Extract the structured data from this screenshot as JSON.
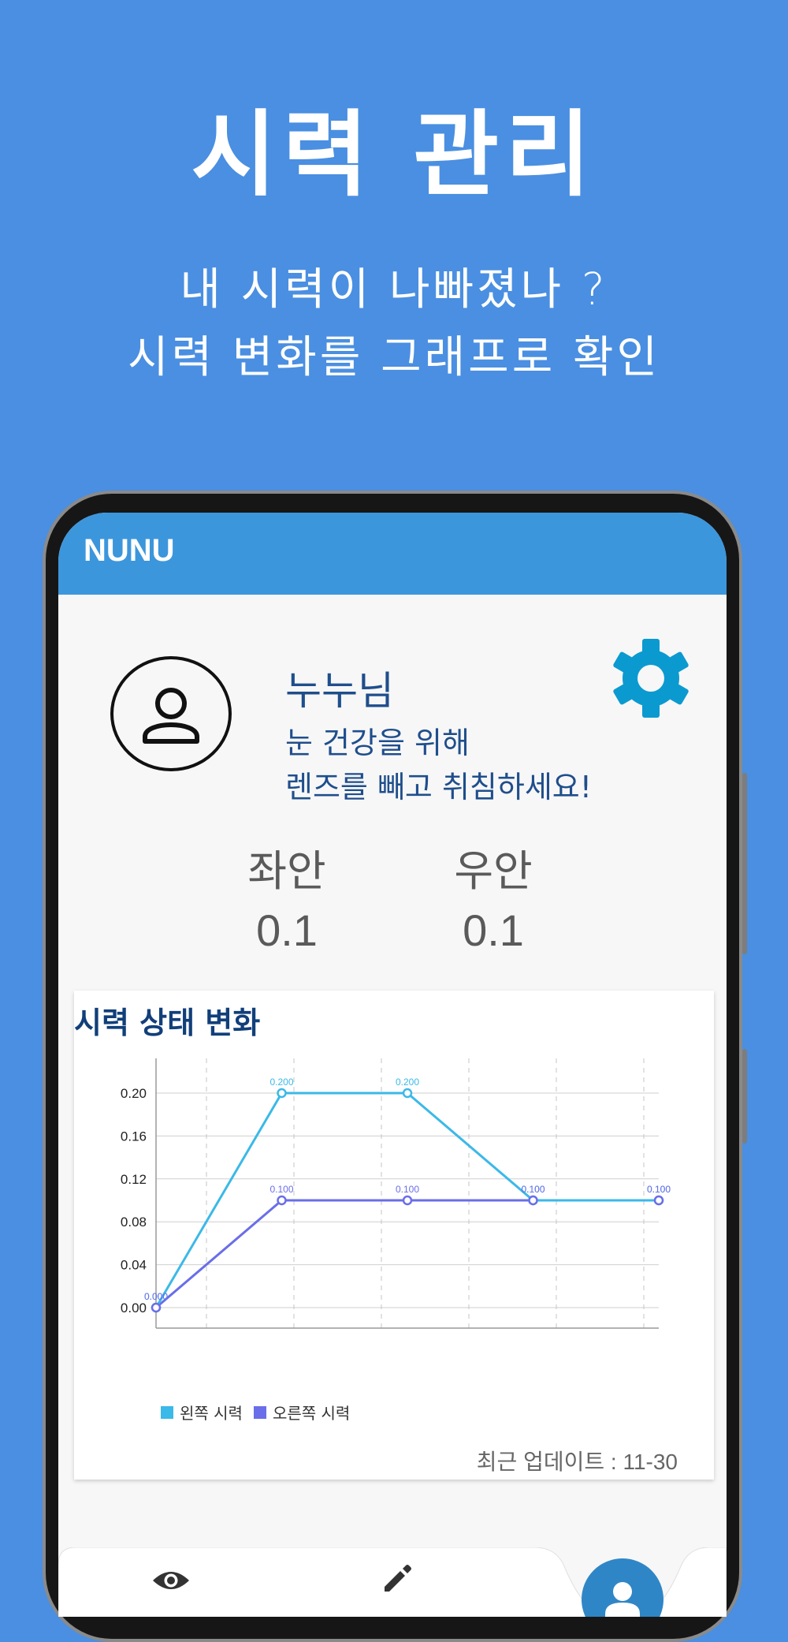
{
  "promo": {
    "title": "시력 관리",
    "line1": "내 시력이 나빠졌나 ?",
    "line2": "시력 변화를 그래프로 확인"
  },
  "app": {
    "title": "NUNU",
    "user_name": "누누님",
    "message_line1": "눈 건강을 위해",
    "message_line2": "렌즈를 빼고 취침하세요!"
  },
  "eyes": {
    "left_label": "좌안",
    "left_value": "0.1",
    "right_label": "우안",
    "right_value": "0.1"
  },
  "chart_card": {
    "title": "시력 상태 변화",
    "update_text": "최근 업데이트 : 11-30"
  },
  "chart_data": {
    "type": "line",
    "title": "시력 상태 변화",
    "x": [
      0,
      1,
      2,
      3,
      4
    ],
    "ylim": [
      0.0,
      0.2
    ],
    "yticks": [
      "0.00",
      "0.04",
      "0.08",
      "0.12",
      "0.16",
      "0.20"
    ],
    "grid": true,
    "legend": "bottom-left",
    "series": [
      {
        "name": "왼쪽 시력",
        "color": "#3bb9e8",
        "values": [
          0.0,
          0.2,
          0.2,
          0.1,
          0.1
        ],
        "labels": [
          "0.000",
          "0.200",
          "0.200",
          "0.100",
          "0.100"
        ]
      },
      {
        "name": "오른쪽 시력",
        "color": "#6a6ee8",
        "values": [
          0.0,
          0.1,
          0.1,
          0.1,
          0.1
        ],
        "labels": [
          "0.000",
          "0.100",
          "0.100",
          "0.100",
          "0.100"
        ]
      }
    ]
  },
  "colors": {
    "background": "#4a8fe1",
    "appbar": "#3c96dc",
    "accent": "#0b9ad0",
    "fab": "#2f86c6"
  },
  "icons": {
    "settings": "gear-icon",
    "profile": "person-icon",
    "nav_eye": "eye-icon",
    "nav_edit": "pencil-icon",
    "fab": "person-icon"
  }
}
